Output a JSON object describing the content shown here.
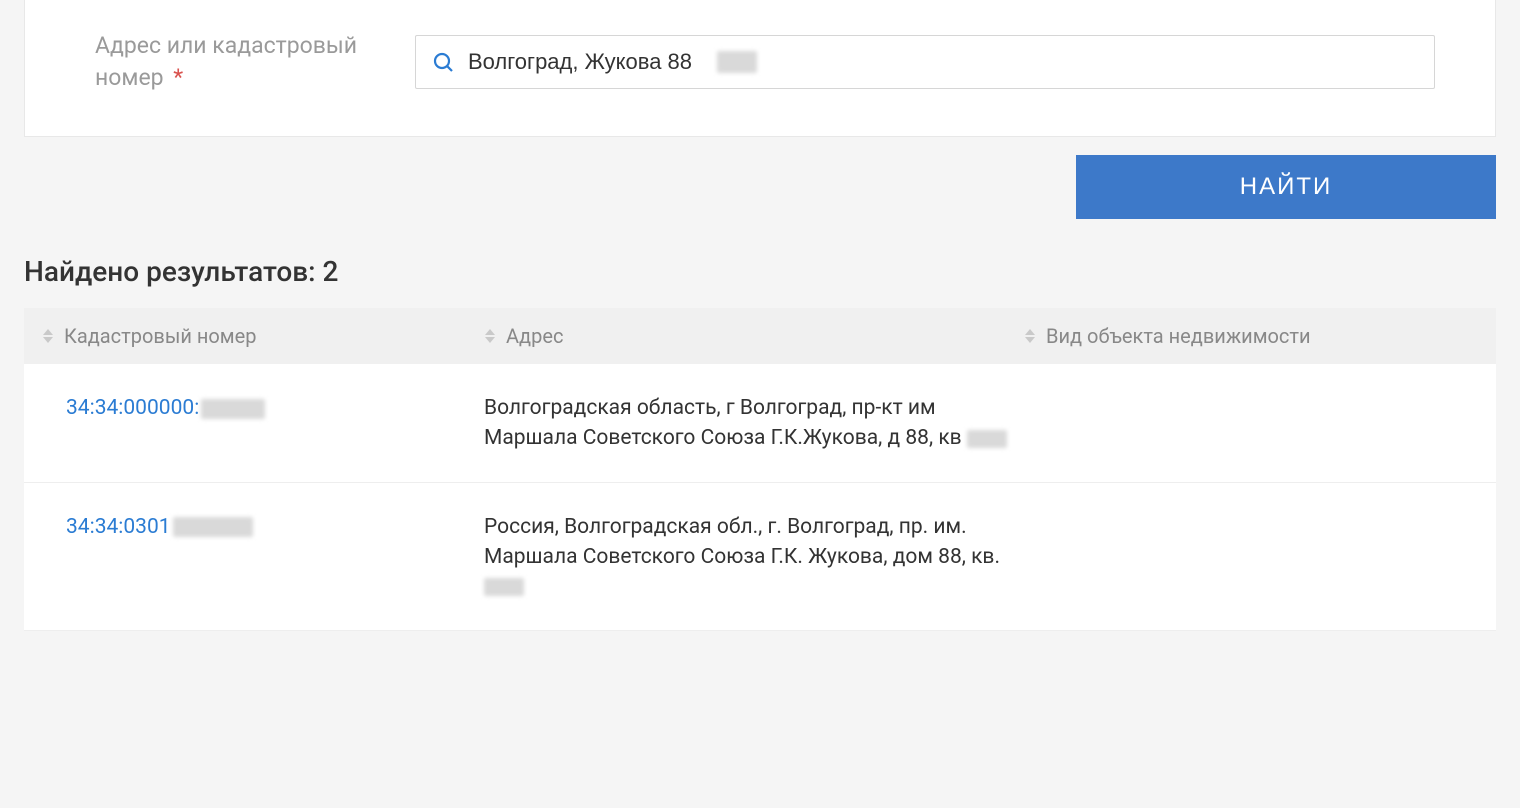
{
  "search": {
    "label": "Адрес или кадастровый номер",
    "required_mark": "*",
    "value": "Волгоград, Жукова 88",
    "icon": "search-icon"
  },
  "actions": {
    "find": "НАЙТИ"
  },
  "results": {
    "title": "Найдено результатов: 2",
    "columns": {
      "cadastral": "Кадастровый номер",
      "address": "Адрес",
      "type": "Вид объекта недвижимости"
    },
    "rows": [
      {
        "cadastral_visible": "34:34:000000:",
        "address_visible": "Волгоградская область, г Волгоград, пр-кт им Маршала Советского Союза Г.К.Жукова, д 88, кв",
        "type": ""
      },
      {
        "cadastral_visible": "34:34:0301",
        "address_visible": "Россия, Волгоградская обл., г. Волгоград, пр. им. Маршала Советского Союза Г.К. Жукова, дом 88, кв.",
        "type": ""
      }
    ]
  },
  "colors": {
    "accent": "#3d79c9",
    "link": "#2b7cd3",
    "muted": "#9a9a9a"
  }
}
